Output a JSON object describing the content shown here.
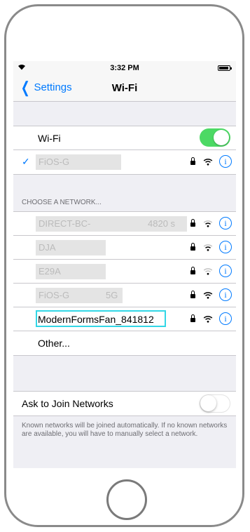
{
  "status": {
    "time": "3:32 PM"
  },
  "nav": {
    "back_label": "Settings",
    "title": "Wi-Fi"
  },
  "wifi": {
    "label": "Wi-Fi",
    "enabled": true,
    "connected_network": "FiOS-G"
  },
  "choose_header": "CHOOSE A NETWORK...",
  "networks": [
    {
      "name": "DIRECT-BC-",
      "suffix": "4820 s",
      "secured": true
    },
    {
      "name": "DJA",
      "secured": true
    },
    {
      "name": "E29A",
      "secured": true
    },
    {
      "name": "FiOS-G",
      "suffix": "5G",
      "secured": true
    },
    {
      "name": "ModernFormsFan_841812",
      "secured": true
    }
  ],
  "other_label": "Other...",
  "ask_join": {
    "label": "Ask to Join Networks",
    "enabled": false,
    "footer": "Known networks will be joined automatically. If no known networks are available, you will have to manually select a network."
  },
  "colors": {
    "accent": "#007aff",
    "toggle_on": "#4cd964",
    "highlight": "#33d7e6"
  }
}
